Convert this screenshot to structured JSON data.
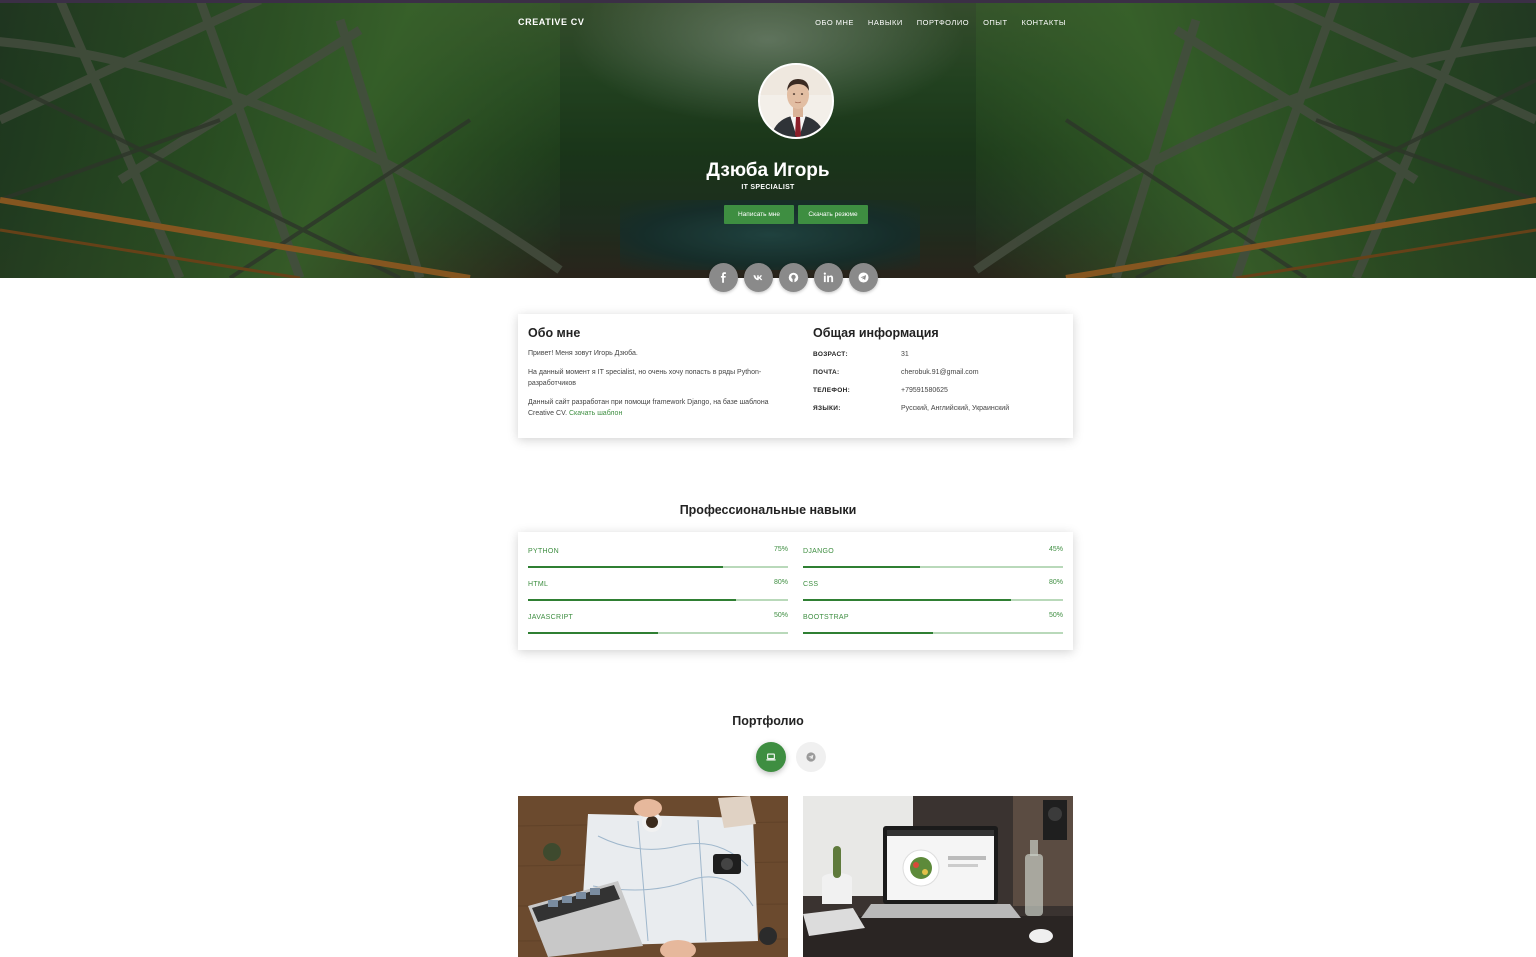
{
  "nav": {
    "brand": "CREATIVE CV",
    "items": [
      "ОБО МНЕ",
      "НАВЫКИ",
      "ПОРТФОЛИО",
      "ОПЫТ",
      "КОНТАКТЫ"
    ]
  },
  "profile": {
    "name": "Дзюба Игорь",
    "role": "IT SPECIALIST",
    "btn_contact": "Написать мне",
    "btn_resume": "Скачать резюме"
  },
  "social": [
    "facebook-icon",
    "vk-icon",
    "github-icon",
    "linkedin-icon",
    "telegram-icon"
  ],
  "about": {
    "title": "Обо мне",
    "p1": "Привет! Меня зовут Игорь Дзюба.",
    "p2": "На данный момент я IT specialist, но очень хочу попасть в ряды Python-разработчиков",
    "p3": "Данный сайт разработан при помощи framework Django, на базе шаблона Creative CV.",
    "p3_link": "Скачать шаблон"
  },
  "info": {
    "title": "Общая информация",
    "rows": [
      {
        "k": "ВОЗРАСТ:",
        "v": "31"
      },
      {
        "k": "ПОЧТА:",
        "v": "cherobuk.91@gmail.com"
      },
      {
        "k": "ТЕЛЕФОН:",
        "v": "+79591580625"
      },
      {
        "k": "ЯЗЫКИ:",
        "v": "Русский, Английский, Украинский"
      }
    ]
  },
  "skills": {
    "title": "Профессиональные навыки",
    "items": [
      {
        "name": "PYTHON",
        "pct": "75%",
        "value": 0.75
      },
      {
        "name": "DJANGO",
        "pct": "45%",
        "value": 0.45
      },
      {
        "name": "HTML",
        "pct": "80%",
        "value": 0.8
      },
      {
        "name": "CSS",
        "pct": "80%",
        "value": 0.8
      },
      {
        "name": "JAVASCRIPT",
        "pct": "50%",
        "value": 0.5
      },
      {
        "name": "BOOTSTRAP",
        "pct": "50%",
        "value": 0.5
      }
    ]
  },
  "portfolio": {
    "title": "Портфолио",
    "tabs": [
      "laptop-icon",
      "telegram-icon"
    ]
  },
  "colors": {
    "accent": "#3e8e41",
    "accent_light": "#b9d9ba",
    "social_bg": "#8a8a8a"
  }
}
